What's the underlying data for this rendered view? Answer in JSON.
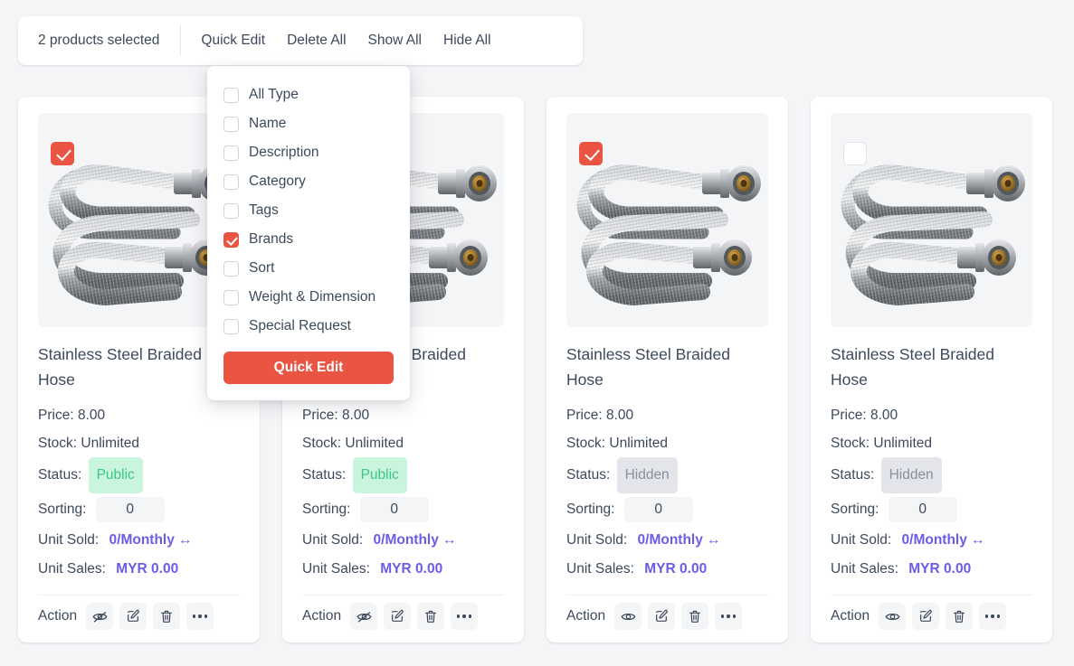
{
  "toolbar": {
    "selected_count_text": "2 products selected",
    "actions": [
      {
        "label": "Quick Edit",
        "name": "quick-edit"
      },
      {
        "label": "Delete All",
        "name": "delete-all"
      },
      {
        "label": "Show All",
        "name": "show-all"
      },
      {
        "label": "Hide All",
        "name": "hide-all"
      }
    ]
  },
  "dropdown": {
    "visible": true,
    "options": [
      {
        "label": "All Type",
        "checked": false
      },
      {
        "label": "Name",
        "checked": false
      },
      {
        "label": "Description",
        "checked": false
      },
      {
        "label": "Category",
        "checked": false
      },
      {
        "label": "Tags",
        "checked": false
      },
      {
        "label": "Brands",
        "checked": true
      },
      {
        "label": "Sort",
        "checked": false
      },
      {
        "label": "Weight & Dimension",
        "checked": false
      },
      {
        "label": "Special Request",
        "checked": false
      }
    ],
    "submit_label": "Quick Edit"
  },
  "labels": {
    "price": "Price:",
    "stock": "Stock:",
    "status": "Status:",
    "sorting": "Sorting:",
    "unit_sold": "Unit Sold:",
    "unit_sales": "Unit Sales:",
    "action": "Action"
  },
  "colors": {
    "accent_red": "#ea5443",
    "link_purple": "#6b5ce7",
    "public_text": "#3ec389",
    "public_bg": "#c9f5dd",
    "hidden_text": "#8a90a0",
    "hidden_bg": "#e4e5ea",
    "page_bg": "#f4f5f7"
  },
  "products": [
    {
      "title": "Stainless Steel Braided Hose",
      "price": "8.00",
      "stock": "Unlimited",
      "status": "Public",
      "status_kind": "public",
      "sorting": "0",
      "unit_sold": "0/Monthly ↔",
      "unit_sales": "MYR 0.00",
      "selected": true,
      "visibility_icon": "eye-off-icon"
    },
    {
      "title": "Stainless Steel Braided Hose",
      "price": "8.00",
      "stock": "Unlimited",
      "status": "Public",
      "status_kind": "public",
      "sorting": "0",
      "unit_sold": "0/Monthly ↔",
      "unit_sales": "MYR 0.00",
      "selected": false,
      "visibility_icon": "eye-off-icon"
    },
    {
      "title": "Stainless Steel Braided Hose",
      "price": "8.00",
      "stock": "Unlimited",
      "status": "Hidden",
      "status_kind": "hidden",
      "sorting": "0",
      "unit_sold": "0/Monthly ↔",
      "unit_sales": "MYR 0.00",
      "selected": true,
      "visibility_icon": "eye-icon"
    },
    {
      "title": "Stainless Steel Braided Hose",
      "price": "8.00",
      "stock": "Unlimited",
      "status": "Hidden",
      "status_kind": "hidden",
      "sorting": "0",
      "unit_sold": "0/Monthly ↔",
      "unit_sales": "MYR 0.00",
      "selected": false,
      "visibility_icon": "eye-icon"
    }
  ]
}
